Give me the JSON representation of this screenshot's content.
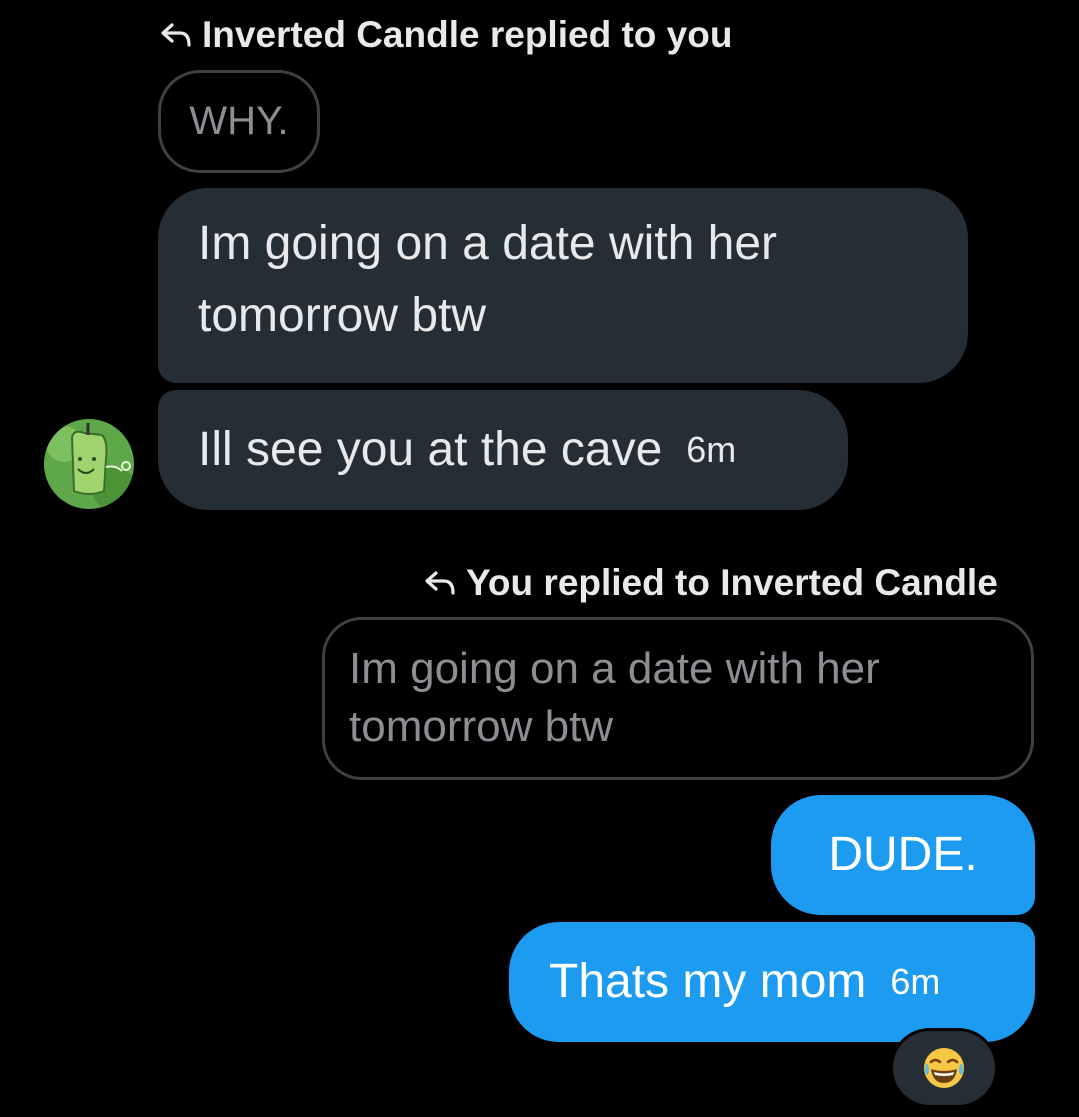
{
  "thread": {
    "received_reply": {
      "context_label": "Inverted Candle replied to you",
      "quoted_text": "WHY."
    },
    "received_messages": [
      {
        "text_line1": "Im going on a date with her",
        "text_line2": "tomorrow btw"
      },
      {
        "text": "Ill see you at the cave",
        "time": "6m"
      }
    ],
    "sender_avatar_icon": "green-candle-avatar",
    "sent_reply": {
      "context_label": "You replied to Inverted Candle",
      "quoted_line1": "Im going on a date with her",
      "quoted_line2": "tomorrow btw"
    },
    "sent_messages": [
      {
        "text": "DUDE."
      },
      {
        "text": "Thats my mom",
        "time": "6m"
      }
    ],
    "reaction": {
      "icon": "laughing-crying-emoji-icon"
    }
  },
  "colors": {
    "background": "#000000",
    "received_bubble": "#262e35",
    "sent_bubble": "#1d9bf0",
    "quote_border": "#3e4144",
    "quote_text": "#8b8f94"
  }
}
